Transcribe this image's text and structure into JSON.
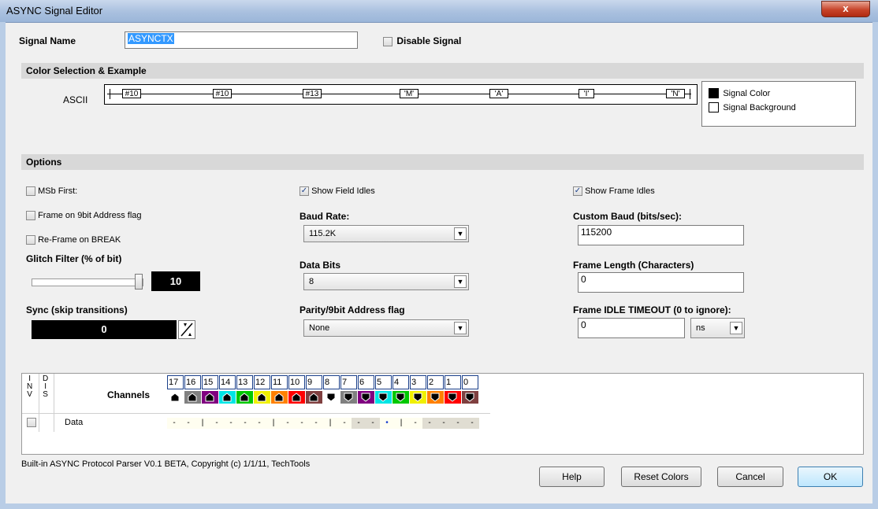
{
  "window": {
    "title": "ASYNC Signal Editor",
    "close_glyph": "x"
  },
  "signal": {
    "name_label": "Signal Name",
    "name_value": "ASYNCTX",
    "disable_label": "Disable  Signal"
  },
  "color_section": {
    "title": "Color Selection & Example",
    "format_label": "ASCII",
    "wave_labels": [
      "#10",
      "#10",
      "#13",
      "'M'",
      "'A'",
      "'I'",
      "'N'"
    ],
    "legend": [
      {
        "label": "Signal Color",
        "color": "#000000"
      },
      {
        "label": "Signal Background",
        "color": "#ffffff"
      }
    ]
  },
  "options": {
    "title": "Options",
    "msb_first": {
      "label": "MSb First:",
      "checked": false
    },
    "frame_9bit": {
      "label": "Frame on 9bit Address flag",
      "checked": false
    },
    "reframe_break": {
      "label": "Re-Frame on BREAK",
      "checked": false
    },
    "glitch_filter": {
      "label": "Glitch Filter (% of bit)",
      "value": "10",
      "slider_fraction": 1.0
    },
    "sync": {
      "label": "Sync (skip transitions)",
      "value": "0"
    },
    "show_field_idles": {
      "label": "Show Field Idles",
      "checked": true
    },
    "baud_rate": {
      "label": "Baud Rate:",
      "value": "115.2K"
    },
    "data_bits": {
      "label": "Data Bits",
      "value": "8"
    },
    "parity": {
      "label": "Parity/9bit Address flag",
      "value": "None"
    },
    "show_frame_idles": {
      "label": "Show Frame Idles",
      "checked": true
    },
    "custom_baud": {
      "label": "Custom Baud (bits/sec):",
      "value": "115200"
    },
    "frame_length": {
      "label": "Frame Length (Characters)",
      "value": "0"
    },
    "idle_timeout": {
      "label": "Frame IDLE TIMEOUT (0 to ignore):",
      "value": "0",
      "unit": "ns"
    }
  },
  "channels": {
    "inv_header": "I\nN\nV",
    "dis_header": "D\nI\nS",
    "title": "Channels",
    "numbers": [
      "17",
      "16",
      "15",
      "14",
      "13",
      "12",
      "11",
      "10",
      "9",
      "8",
      "7",
      "6",
      "5",
      "4",
      "3",
      "2",
      "1",
      "0"
    ],
    "pod_colors": [
      "#ffffff",
      "#808080",
      "#800080",
      "#00e5e5",
      "#00c800",
      "#f0f000",
      "#ff8000",
      "#ff0000",
      "#804040",
      "#ffffff",
      "#808080",
      "#800080",
      "#00e5e5",
      "#00c800",
      "#f0f000",
      "#ff8000",
      "#ff0000",
      "#804040"
    ],
    "row_label": "Data",
    "row_values": [
      "-",
      "-",
      "|",
      "-",
      "-",
      "-",
      "-",
      "|",
      "-",
      "-",
      "-",
      "|",
      "-",
      "-",
      "-",
      "•",
      "|",
      "-",
      "-",
      "-",
      "-",
      "-"
    ]
  },
  "footer": {
    "copyright": "Built-in ASYNC Protocol Parser V0.1 BETA,  Copyright (c) 1/1/11, TechTools",
    "buttons": {
      "help": "Help",
      "reset": "Reset Colors",
      "cancel": "Cancel",
      "ok": "OK"
    }
  }
}
